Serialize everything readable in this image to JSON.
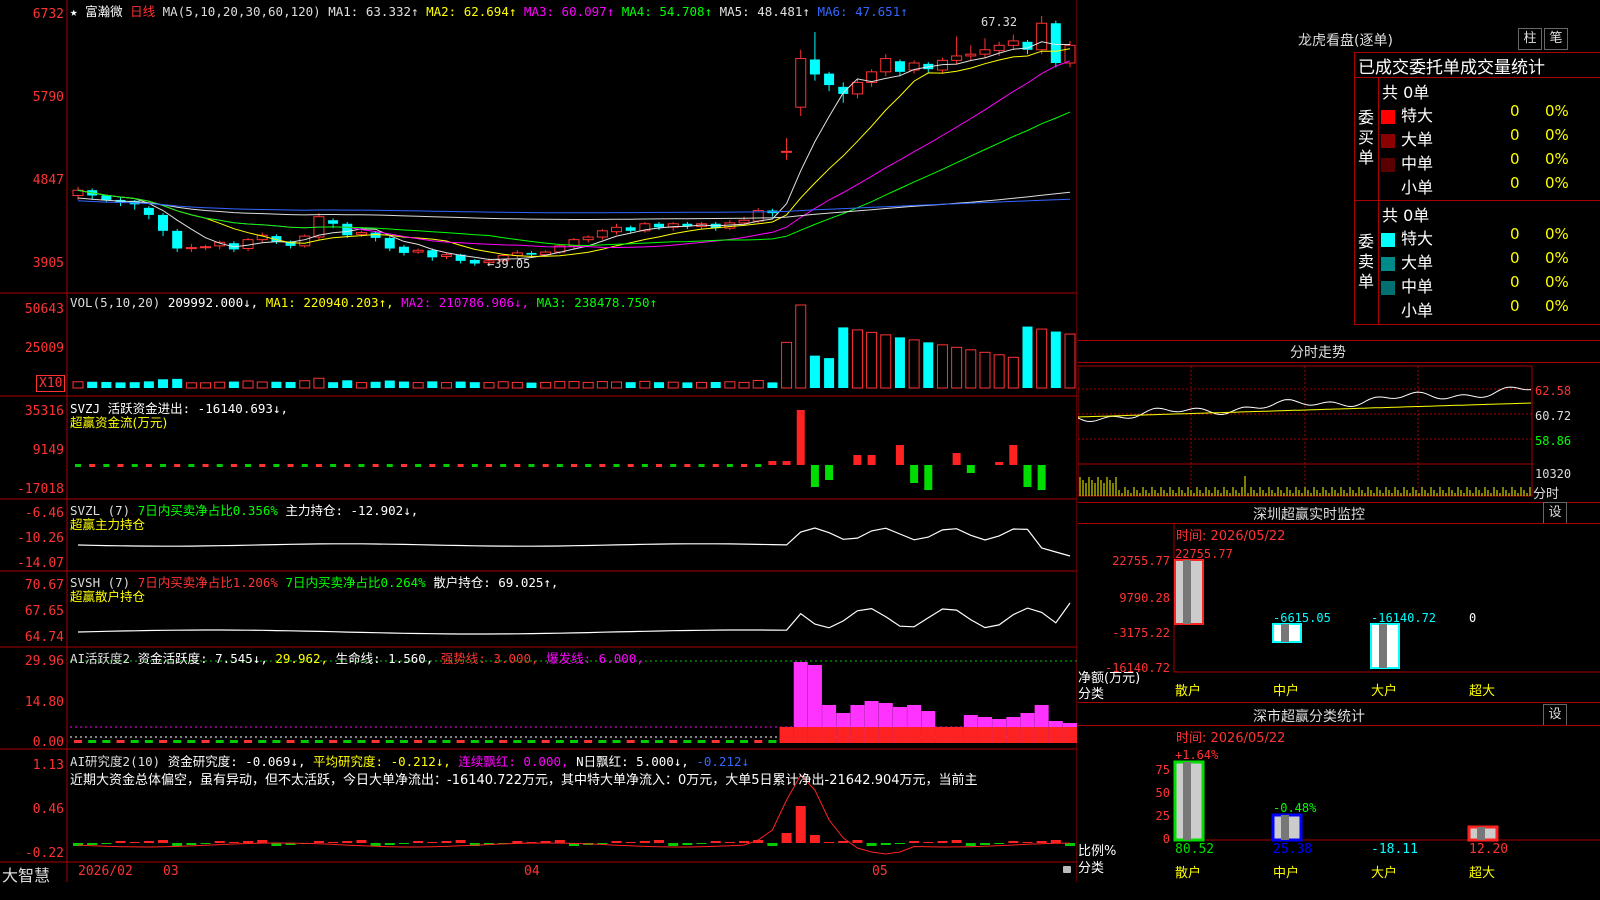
{
  "header": {
    "star": "★",
    "stock_name": "富瀚微",
    "period": "日线",
    "ma_params": "MA(5,10,20,30,60,120)",
    "ma_items": [
      {
        "label": "MA1: 63.332↑",
        "color": "#e0e0e0"
      },
      {
        "label": "MA2: 62.694↑",
        "color": "#ffff00"
      },
      {
        "label": "MA3: 60.097↑",
        "color": "#ff00ff"
      },
      {
        "label": "MA4: 54.708↑",
        "color": "#00ff00"
      },
      {
        "label": "MA5: 48.481↑",
        "color": "#e0e0e0"
      },
      {
        "label": "MA6: 47.651↑",
        "color": "#3366ff"
      }
    ]
  },
  "price_panel": {
    "y_ticks": [
      "6732",
      "5790",
      "4847",
      "3905"
    ],
    "high_label": "67.32",
    "low_label": "←39.05"
  },
  "vol_panel": {
    "header": "VOL(5,10,20)",
    "value": "209992.000↓,",
    "ma_items": [
      {
        "label": "MA1: 220940.203↑,",
        "color": "#ffff00"
      },
      {
        "label": "MA2: 210786.906↓,",
        "color": "#ff00ff"
      },
      {
        "label": "MA3: 238478.750↑",
        "color": "#00ff00"
      }
    ],
    "y_ticks": [
      "50643",
      "25009"
    ],
    "unit_badge": "X10"
  },
  "svzj_panel": {
    "header": "SVZJ  活跃资金进出: -16140.693↓,",
    "subtitle": "超赢资金流(万元)",
    "y_ticks": [
      "35316",
      "9149",
      "-17018"
    ]
  },
  "svzl_panel": {
    "prefix": "SVZL (7)",
    "pct_label": "7日内买卖净占比0.356%",
    "holding": "主力持仓: -12.902↓,",
    "subtitle": "超赢主力持仓",
    "y_ticks": [
      "-6.46",
      "-10.26",
      "-14.07"
    ]
  },
  "svsh_panel": {
    "prefix": "SVSH (7)",
    "pct1": "7日内买卖净占比1.206%",
    "pct2": "7日内买卖净占比0.264%",
    "holding": "散户持仓: 69.025↑,",
    "subtitle": "超赢散户持仓",
    "y_ticks": [
      "70.67",
      "67.65",
      "64.74"
    ]
  },
  "ai1_panel": {
    "prefix": "AI活跃度2",
    "act": "资金活跃度: 7.545↓,",
    "v2": "29.962,",
    "life": "生命线: 1.560,",
    "strong": "强势线: 3.000,",
    "burst": "爆发线: 6.000,",
    "y_ticks": [
      "29.96",
      "14.80",
      "0.00"
    ]
  },
  "ai2_panel": {
    "prefix": "AI研究度2(10)",
    "research": "资金研究度: -0.069↓,",
    "avg": "平均研究度: -0.212↓,",
    "cont": "连续飘红: 0.000,",
    "ndays": "N日飘红: 5.000↓,",
    "last": "-0.212↓",
    "text": "近期大资金总体偏空，虽有异动，但不太活跃，今日大单净流出：-16140.722万元，其中特大单净流入：0万元，大单5日累计净出-21642.904万元，当前主",
    "y_ticks": [
      "1.13",
      "0.46",
      "-0.22"
    ]
  },
  "bottom": {
    "brand": "大智慧",
    "dates": [
      "2026/02",
      "03",
      "04",
      "05"
    ]
  },
  "dragon_panel": {
    "title": "龙虎看盘(逐单)",
    "btn1": "柱",
    "btn2": "笔",
    "header": "已成交委托单成交量统计",
    "buy_label": "委买单",
    "sell_label": "委卖单",
    "buy_total": "共 0单",
    "sell_total": "共 0单",
    "buy_rows": [
      {
        "name": "特大",
        "val": "0",
        "pct": "0%",
        "color": "#ff0000"
      },
      {
        "name": "大单",
        "val": "0",
        "pct": "0%",
        "color": "#8b0000"
      },
      {
        "name": "中单",
        "val": "0",
        "pct": "0%",
        "color": "#5a0000"
      },
      {
        "name": "小单",
        "val": "0",
        "pct": "0%",
        "color": ""
      }
    ],
    "sell_rows": [
      {
        "name": "特大",
        "val": "0",
        "pct": "0%",
        "color": "#00ffff"
      },
      {
        "name": "大单",
        "val": "0",
        "pct": "0%",
        "color": "#008b8b"
      },
      {
        "name": "中单",
        "val": "0",
        "pct": "0%",
        "color": "#007070"
      },
      {
        "name": "小单",
        "val": "0",
        "pct": "0%",
        "color": ""
      }
    ]
  },
  "intraday_panel": {
    "title": "分时走势",
    "y_ticks": [
      "62.58",
      "60.72",
      "58.86"
    ],
    "vol_tick": "10320",
    "label": "分时"
  },
  "sz_monitor": {
    "title": "深圳超赢实时监控",
    "btn": "设",
    "time": "时间: 2026/05/22",
    "y_ticks": [
      "22755.77",
      "9790.28",
      "-3175.22",
      "-16140.72"
    ],
    "axis_label1": "净额(万元)",
    "axis_label2": "分类",
    "bars": [
      {
        "name": "散户",
        "value": "22755.77"
      },
      {
        "name": "中户",
        "value": "-6615.05"
      },
      {
        "name": "大户",
        "value": "-16140.72"
      },
      {
        "name": "超大",
        "value": "0"
      }
    ]
  },
  "sz_class": {
    "title": "深市超赢分类统计",
    "btn": "设",
    "time": "时间: 2026/05/22",
    "y_ticks": [
      "75",
      "50",
      "25",
      "0"
    ],
    "axis_label1": "比例%",
    "axis_label2": "分类",
    "bars": [
      {
        "name": "散户",
        "top": "+1.64%",
        "bottom": "80.52"
      },
      {
        "name": "中户",
        "top": "-0.48%",
        "bottom": "25.38"
      },
      {
        "name": "大户",
        "top": "",
        "bottom": "-18.11"
      },
      {
        "name": "超大",
        "top": "",
        "bottom": "12.20"
      }
    ]
  },
  "chart_data": {
    "type": "candlestick",
    "title": "富瀚微 日线",
    "x_range": [
      "2026/02",
      "2026/05/22"
    ],
    "ylim": [
      39.05,
      67.32
    ],
    "candles": [
      [
        47.0,
        47.6,
        46.8,
        46.5,
        48.0
      ],
      [
        47.6,
        47.0,
        46.6,
        46.5,
        47.8
      ],
      [
        47.0,
        46.5,
        46.3,
        46.2,
        47.1
      ],
      [
        46.5,
        46.2,
        46.0,
        45.8,
        46.8
      ],
      [
        46.4,
        46.0,
        45.5,
        45.4,
        46.5
      ],
      [
        45.6,
        44.8,
        44.5,
        44.3,
        45.8
      ],
      [
        44.8,
        43.0,
        42.6,
        42.4,
        45.0
      ],
      [
        43.0,
        41.0,
        40.8,
        40.6,
        43.2
      ],
      [
        41.0,
        41.1,
        40.8,
        40.6,
        41.5
      ],
      [
        41.1,
        41.2,
        40.9,
        40.8,
        41.4
      ],
      [
        41.3,
        41.7,
        41.0,
        40.9,
        41.9
      ],
      [
        41.6,
        40.9,
        40.7,
        40.6,
        41.8
      ],
      [
        41.0,
        42.0,
        40.8,
        40.7,
        42.2
      ],
      [
        42.0,
        42.5,
        41.8,
        41.7,
        42.8
      ],
      [
        42.4,
        41.8,
        41.6,
        41.5,
        42.6
      ],
      [
        41.8,
        41.3,
        41.1,
        41.0,
        41.9
      ],
      [
        41.3,
        42.4,
        41.2,
        41.1,
        42.6
      ],
      [
        42.3,
        44.6,
        42.0,
        41.9,
        45.0
      ],
      [
        44.2,
        43.8,
        43.5,
        43.3,
        44.4
      ],
      [
        43.8,
        42.5,
        42.3,
        42.2,
        44.0
      ],
      [
        42.6,
        42.8,
        42.4,
        42.3,
        43.0
      ],
      [
        42.8,
        42.2,
        42.0,
        41.8,
        43.0
      ],
      [
        42.2,
        41.0,
        40.8,
        40.7,
        42.4
      ],
      [
        41.2,
        40.5,
        40.3,
        40.2,
        41.4
      ],
      [
        40.6,
        40.8,
        40.5,
        40.4,
        41.0
      ],
      [
        40.8,
        40.0,
        39.8,
        39.6,
        41.0
      ],
      [
        40.1,
        40.3,
        39.9,
        39.8,
        40.5
      ],
      [
        40.3,
        39.6,
        39.4,
        39.3,
        40.4
      ],
      [
        39.7,
        39.3,
        39.1,
        39.05,
        39.8
      ],
      [
        39.4,
        39.6,
        39.2,
        39.1,
        39.9
      ],
      [
        39.6,
        40.2,
        39.5,
        39.4,
        40.4
      ],
      [
        40.2,
        40.5,
        40.0,
        39.9,
        40.8
      ],
      [
        40.5,
        40.3,
        40.1,
        40.0,
        40.7
      ],
      [
        40.3,
        40.6,
        40.2,
        40.1,
        40.8
      ],
      [
        40.6,
        41.3,
        40.5,
        40.4,
        41.5
      ],
      [
        41.3,
        42.0,
        41.1,
        41.0,
        42.2
      ],
      [
        42.0,
        42.3,
        41.8,
        41.7,
        42.5
      ],
      [
        42.3,
        43.0,
        42.1,
        42.0,
        43.2
      ],
      [
        42.9,
        43.4,
        42.7,
        42.6,
        43.8
      ],
      [
        43.4,
        43.0,
        42.8,
        42.7,
        43.6
      ],
      [
        43.0,
        43.8,
        42.9,
        42.8,
        44.0
      ],
      [
        43.8,
        43.4,
        43.2,
        43.1,
        44.0
      ],
      [
        43.4,
        43.8,
        43.2,
        43.0,
        44.0
      ],
      [
        43.8,
        43.5,
        43.3,
        43.2,
        44.0
      ],
      [
        43.5,
        43.8,
        43.3,
        43.2,
        44.0
      ],
      [
        43.8,
        43.3,
        43.1,
        43.0,
        44.0
      ],
      [
        43.3,
        43.9,
        43.2,
        43.1,
        44.2
      ],
      [
        43.9,
        44.2,
        43.7,
        43.6,
        44.6
      ],
      [
        44.1,
        45.3,
        44.0,
        43.9,
        45.6
      ],
      [
        45.3,
        45.0,
        44.8,
        44.6,
        45.5
      ],
      [
        52.0,
        52.0,
        51.5,
        51.0,
        53.5
      ],
      [
        57.0,
        62.5,
        56.5,
        56.0,
        63.5
      ],
      [
        62.4,
        60.7,
        60.5,
        60.0,
        65.5
      ],
      [
        60.8,
        59.5,
        59.3,
        58.8,
        61.0
      ],
      [
        59.3,
        58.5,
        58.0,
        57.5,
        59.8
      ],
      [
        58.5,
        59.8,
        58.3,
        58.0,
        60.2
      ],
      [
        59.8,
        61.0,
        59.5,
        59.3,
        61.3
      ],
      [
        61.0,
        62.5,
        60.8,
        60.5,
        63.0
      ],
      [
        62.2,
        61.0,
        60.7,
        60.5,
        62.4
      ],
      [
        61.2,
        62.0,
        61.0,
        60.8,
        62.3
      ],
      [
        61.9,
        61.3,
        61.0,
        60.9,
        62.1
      ],
      [
        61.2,
        62.3,
        61.0,
        60.8,
        62.6
      ],
      [
        62.3,
        62.8,
        62.0,
        61.8,
        65.0
      ],
      [
        62.8,
        63.0,
        62.5,
        62.3,
        64.0
      ],
      [
        63.0,
        63.5,
        62.8,
        62.5,
        64.8
      ],
      [
        63.4,
        64.0,
        63.1,
        62.8,
        64.4
      ],
      [
        64.0,
        64.5,
        63.8,
        63.5,
        65.2
      ],
      [
        64.4,
        63.5,
        63.2,
        63.0,
        64.6
      ],
      [
        63.5,
        66.5,
        63.3,
        63.0,
        67.32
      ],
      [
        66.5,
        62.0,
        61.8,
        61.5,
        66.8
      ],
      [
        62.0,
        64.0,
        61.8,
        61.5,
        64.5
      ]
    ]
  }
}
